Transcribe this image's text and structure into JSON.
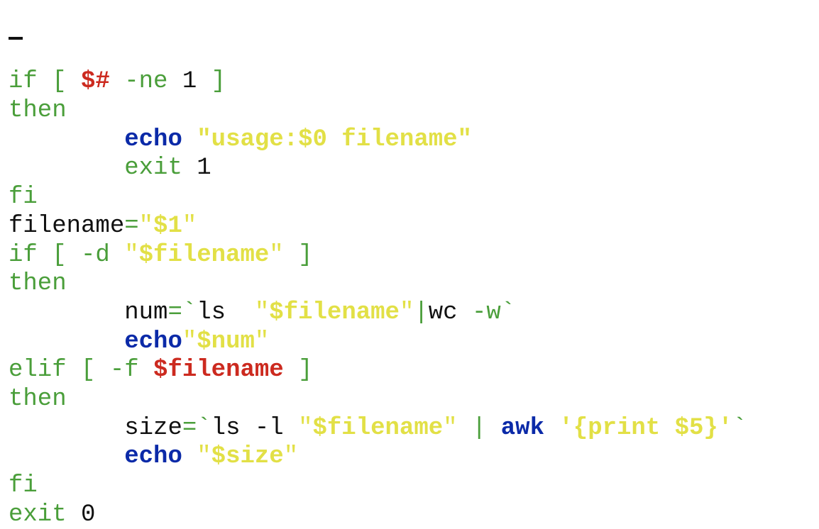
{
  "editor": {
    "lines": [
      [
        [
          "if",
          "kw"
        ],
        [
          " [ ",
          "kw"
        ],
        [
          "$#",
          "red"
        ],
        [
          " -ne ",
          "kw"
        ],
        [
          "1",
          "plain"
        ],
        [
          " ]",
          "kw"
        ]
      ],
      [
        [
          "then",
          "kw"
        ]
      ],
      [
        [
          "        ",
          "plain"
        ],
        [
          "echo",
          "blue"
        ],
        [
          " ",
          "plain"
        ],
        [
          "\"usage:$0 filename\"",
          "str"
        ]
      ],
      [
        [
          "        ",
          "plain"
        ],
        [
          "exit",
          "kw"
        ],
        [
          " ",
          "plain"
        ],
        [
          "1",
          "plain"
        ]
      ],
      [
        [
          "fi",
          "kw"
        ]
      ],
      [
        [
          "filename",
          "plain"
        ],
        [
          "=",
          "kw"
        ],
        [
          "\"",
          "strq"
        ],
        [
          "$1",
          "str"
        ],
        [
          "\"",
          "strq"
        ]
      ],
      [
        [
          "if",
          "kw"
        ],
        [
          " [ -d ",
          "kw"
        ],
        [
          "\"",
          "strq"
        ],
        [
          "$filename",
          "str"
        ],
        [
          "\"",
          "strq"
        ],
        [
          " ]",
          "kw"
        ]
      ],
      [
        [
          "then",
          "kw"
        ]
      ],
      [
        [
          "        ",
          "plain"
        ],
        [
          "num",
          "plain"
        ],
        [
          "=`",
          "kw"
        ],
        [
          "ls  ",
          "plain"
        ],
        [
          "\"",
          "strq"
        ],
        [
          "$filename",
          "str"
        ],
        [
          "\"",
          "strq"
        ],
        [
          "|",
          "kw"
        ],
        [
          "wc ",
          "plain"
        ],
        [
          "-w`",
          "kw"
        ]
      ],
      [
        [
          "        ",
          "plain"
        ],
        [
          "echo",
          "blue"
        ],
        [
          "\"",
          "strq"
        ],
        [
          "$num",
          "str"
        ],
        [
          "\"",
          "strq"
        ]
      ],
      [
        [
          "elif",
          "kw"
        ],
        [
          " [ -f ",
          "kw"
        ],
        [
          "$filename",
          "red"
        ],
        [
          " ]",
          "kw"
        ]
      ],
      [
        [
          "then",
          "kw"
        ]
      ],
      [
        [
          "        ",
          "plain"
        ],
        [
          "size",
          "plain"
        ],
        [
          "=`",
          "kw"
        ],
        [
          "ls -l ",
          "plain"
        ],
        [
          "\"",
          "strq"
        ],
        [
          "$filename",
          "str"
        ],
        [
          "\"",
          "strq"
        ],
        [
          " | ",
          "kw"
        ],
        [
          "awk",
          "blue"
        ],
        [
          " ",
          "plain"
        ],
        [
          "'{print $5}'",
          "str"
        ],
        [
          "`",
          "kw"
        ]
      ],
      [
        [
          "        ",
          "plain"
        ],
        [
          "echo",
          "blue"
        ],
        [
          " ",
          "plain"
        ],
        [
          "\"",
          "strq"
        ],
        [
          "$size",
          "str"
        ],
        [
          "\"",
          "strq"
        ]
      ],
      [
        [
          "fi",
          "kw"
        ]
      ],
      [
        [
          "exit",
          "kw"
        ],
        [
          " ",
          "plain"
        ],
        [
          "0",
          "plain"
        ]
      ]
    ]
  },
  "colors": {
    "keyword": "#4a9e3a",
    "plain": "#111111",
    "variable_red": "#cc2a1f",
    "builtin_blue": "#0b2aa8",
    "string_yellow": "#e2e046"
  }
}
